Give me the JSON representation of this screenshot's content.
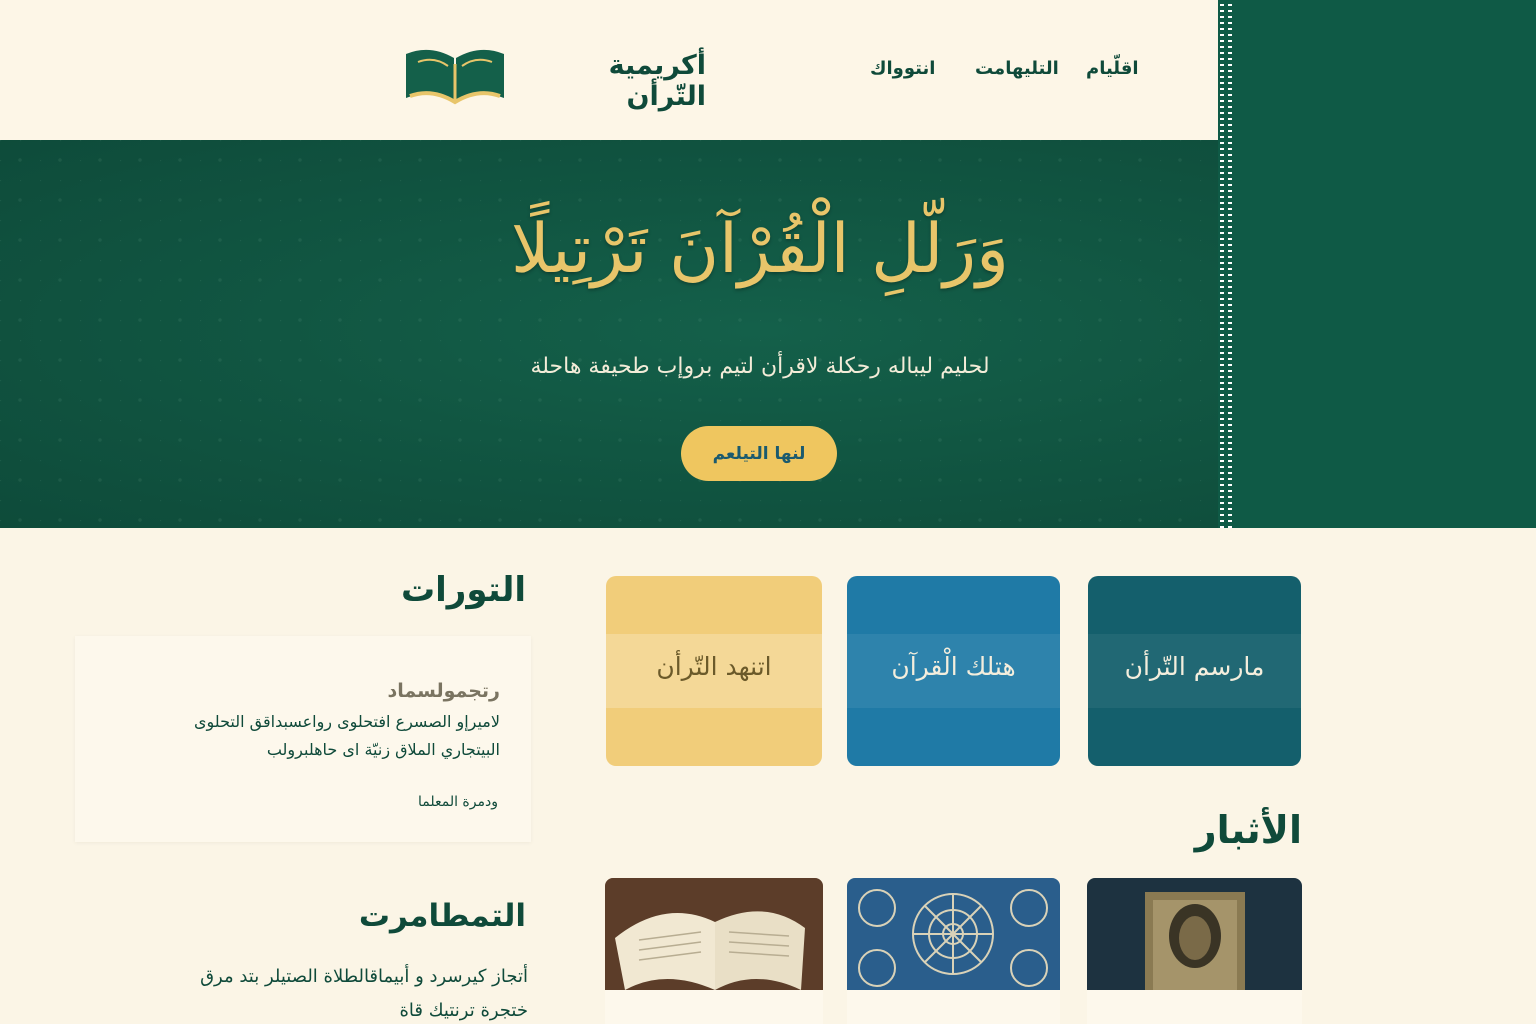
{
  "header": {
    "brand": "أكريمية التّرأن",
    "nav": [
      "اقلّيام",
      "التليهامت",
      "انتوواك"
    ]
  },
  "hero": {
    "title": "وَرَلّلِ الْقُرْآنَ تَرْتِيلًا",
    "subtitle": "لحليم ليباله رحكلة لاقرأن لتيم بروإب طحيفة هاحلة",
    "button": "لنها التيلعم"
  },
  "categories": [
    "مارسم التّرأن",
    "هتلك الْقرآن",
    "اتنهد التّرأن"
  ],
  "news": {
    "heading": "الأثبار",
    "items": [
      "",
      "",
      ""
    ]
  },
  "courses": {
    "heading": "التورات",
    "title": "رتجمولسماد",
    "lines": [
      "لاميرإو الصسرع افتحلوى رواعسبداقق التحلوى",
      "البيتجاري الملاق زنيّة اى حاهلبرولب"
    ],
    "more": "ودمرة المعلما"
  },
  "events": {
    "heading": "التمطامرت",
    "lines": [
      "أتجاز كيرسرد و أبيماقالطلاة الصتيلر بتد مرق",
      "ختجرة ترنتيك قاة"
    ]
  },
  "colors": {
    "primary_green": "#0f5a46",
    "gold": "#e8c56a",
    "button_gold": "#efc65f",
    "cream": "#fbf5e6",
    "teal": "#145f6c",
    "blue": "#1f7aa6",
    "sand": "#f1cd7a"
  },
  "icons": {
    "logo": "open-book-icon"
  }
}
